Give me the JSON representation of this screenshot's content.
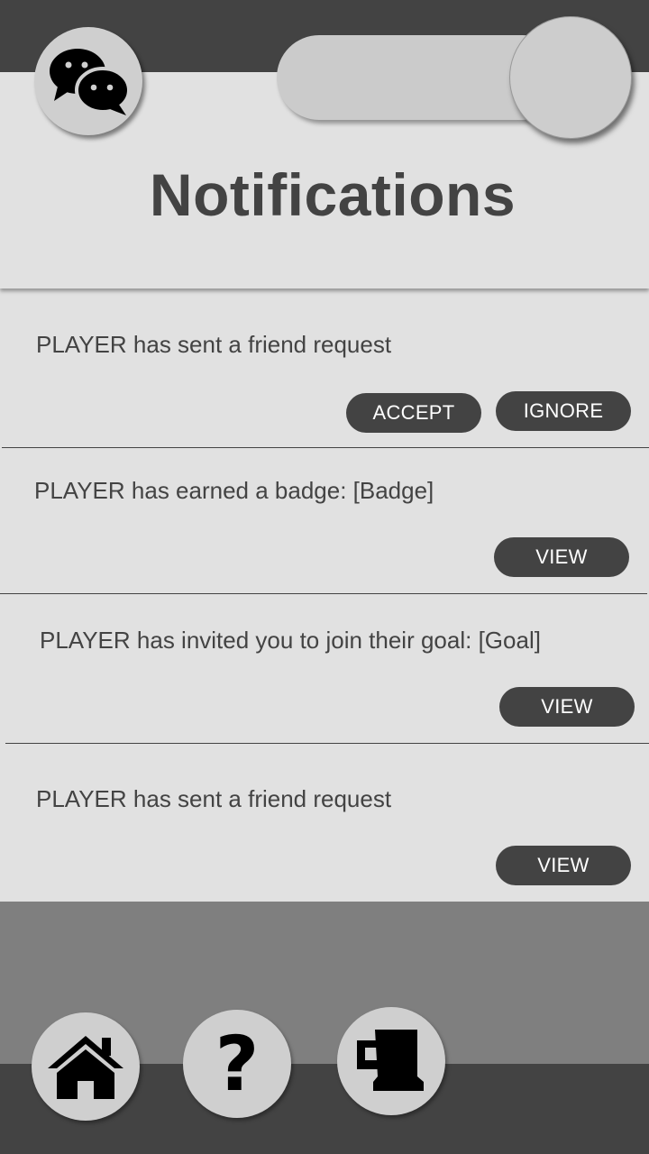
{
  "header": {
    "title": "Notifications",
    "chat_button_icon": "chat-bubbles-icon",
    "toggle": {
      "state": "on"
    }
  },
  "notifications": [
    {
      "text": "PLAYER has sent a friend request",
      "actions": [
        {
          "label": "ACCEPT"
        },
        {
          "label": "IGNORE"
        }
      ]
    },
    {
      "text": "PLAYER has earned a badge: [Badge]",
      "actions": [
        {
          "label": "VIEW"
        }
      ]
    },
    {
      "text": "PLAYER has invited you to join their goal:  [Goal]",
      "actions": [
        {
          "label": "VIEW"
        }
      ]
    },
    {
      "text": "PLAYER has sent a friend request",
      "actions": [
        {
          "label": "VIEW"
        }
      ]
    }
  ],
  "bottom_nav": {
    "items": [
      {
        "icon": "home-icon"
      },
      {
        "icon": "help-icon",
        "glyph": "?"
      },
      {
        "icon": "mug-icon"
      }
    ]
  },
  "colors": {
    "dark": "#434343",
    "background": "#e1e1e1",
    "button_light": "#cfcfcf",
    "footer_gray": "#7f7f7f"
  }
}
